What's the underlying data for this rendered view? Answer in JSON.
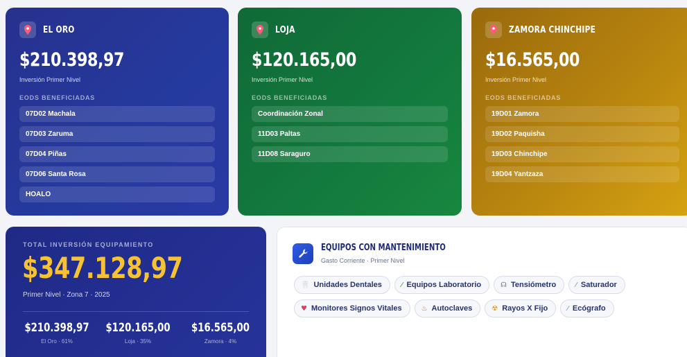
{
  "regions": [
    {
      "name": "EL ORO",
      "amount": "$210.398,97",
      "subtitle": "Inversión Primer Nivel",
      "eods_label": "EODS BENEFICIADAS",
      "eods": [
        "07D02 Machala",
        "07D03 Zaruma",
        "07D04 Piñas",
        "07D06 Santa Rosa",
        "HOALO"
      ],
      "color": "#27318e"
    },
    {
      "name": "LOJA",
      "amount": "$120.165,00",
      "subtitle": "Inversión Primer Nivel",
      "eods_label": "EODS BENEFICIADAS",
      "eods": [
        "Coordinación Zonal",
        "11D03 Paltas",
        "11D08 Saraguro"
      ],
      "color": "#137a3e"
    },
    {
      "name": "ZAMORA CHINCHIPE",
      "amount": "$16.565,00",
      "subtitle": "Inversión Primer Nivel",
      "eods_label": "EODS BENEFICIADAS",
      "eods": [
        "19D01 Zamora",
        "19D02 Paquisha",
        "19D03 Chinchipe",
        "19D04 Yantzaza"
      ],
      "color": "#b8850f"
    }
  ],
  "total": {
    "label": "TOTAL INVERSIÓN EQUIPAMIENTO",
    "amount": "$347.128,97",
    "subtitle": "Primer Nivel · Zona 7 · 2025",
    "amount_color": "#f6c233",
    "breakdown": [
      {
        "value": "$210.398,97",
        "label": "El Oro · 61%"
      },
      {
        "value": "$120.165,00",
        "label": "Loja · 35%"
      },
      {
        "value": "$16.565,00",
        "label": "Zamora · 4%"
      }
    ]
  },
  "equipment": {
    "title": "EQUIPOS CON MANTENIMIENTO",
    "subtitle": "Gasto Corriente · Primer Nivel",
    "icon": "wrench-icon",
    "chips": [
      {
        "label": "Unidades Dentales",
        "icon": "tooth-icon"
      },
      {
        "label": "Equipos Laboratorio",
        "icon": "pipette-icon"
      },
      {
        "label": "Tensiómetro",
        "icon": "stethoscope-icon"
      },
      {
        "label": "Saturador",
        "icon": "syringe-icon"
      },
      {
        "label": "Monitores Signos Vitales",
        "icon": "heart-icon"
      },
      {
        "label": "Autoclaves",
        "icon": "flame-icon"
      },
      {
        "label": "Rayos X Fijo",
        "icon": "radiation-icon"
      },
      {
        "label": "Ecógrafo",
        "icon": "probe-icon"
      }
    ]
  }
}
